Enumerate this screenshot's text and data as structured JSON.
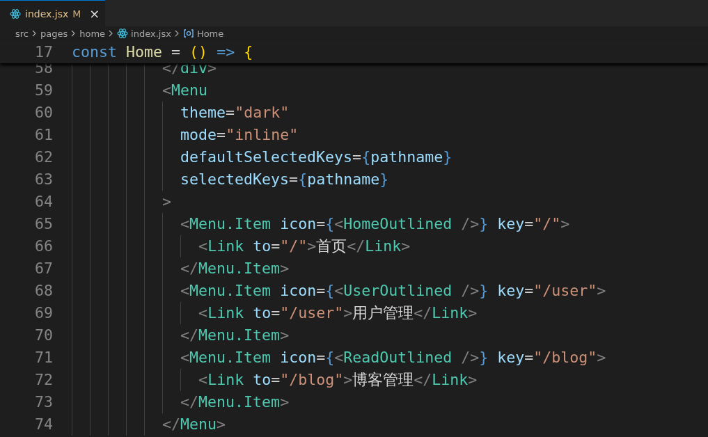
{
  "tabs": [
    {
      "label": "index.jsx",
      "status": "M",
      "close": "×",
      "selected": true
    }
  ],
  "breadcrumb": [
    {
      "kind": "folder",
      "label": "src"
    },
    {
      "kind": "folder",
      "label": "pages"
    },
    {
      "kind": "folder",
      "label": "home"
    },
    {
      "kind": "react",
      "label": "index.jsx"
    },
    {
      "kind": "symbol",
      "label": "Home"
    }
  ],
  "sticky_line": {
    "number": "17",
    "text": "const Home = () => {"
  },
  "lines": [
    {
      "number": "58",
      "text": "          </div>"
    },
    {
      "number": "59",
      "text": "          <Menu"
    },
    {
      "number": "60",
      "text": "            theme=\"dark\""
    },
    {
      "number": "61",
      "text": "            mode=\"inline\""
    },
    {
      "number": "62",
      "text": "            defaultSelectedKeys={pathname}"
    },
    {
      "number": "63",
      "text": "            selectedKeys={pathname}"
    },
    {
      "number": "64",
      "text": "          >"
    },
    {
      "number": "65",
      "text": "            <Menu.Item icon={<HomeOutlined />} key=\"/\">"
    },
    {
      "number": "66",
      "text": "              <Link to=\"/\">首页</Link>"
    },
    {
      "number": "67",
      "text": "            </Menu.Item>"
    },
    {
      "number": "68",
      "text": "            <Menu.Item icon={<UserOutlined />} key=\"/user\">"
    },
    {
      "number": "69",
      "text": "              <Link to=\"/user\">用户管理</Link>"
    },
    {
      "number": "70",
      "text": "            </Menu.Item>"
    },
    {
      "number": "71",
      "text": "            <Menu.Item icon={<ReadOutlined />} key=\"/blog\">"
    },
    {
      "number": "72",
      "text": "              <Link to=\"/blog\">博客管理</Link>"
    },
    {
      "number": "73",
      "text": "            </Menu.Item>"
    },
    {
      "number": "74",
      "text": "          </Menu>"
    }
  ]
}
